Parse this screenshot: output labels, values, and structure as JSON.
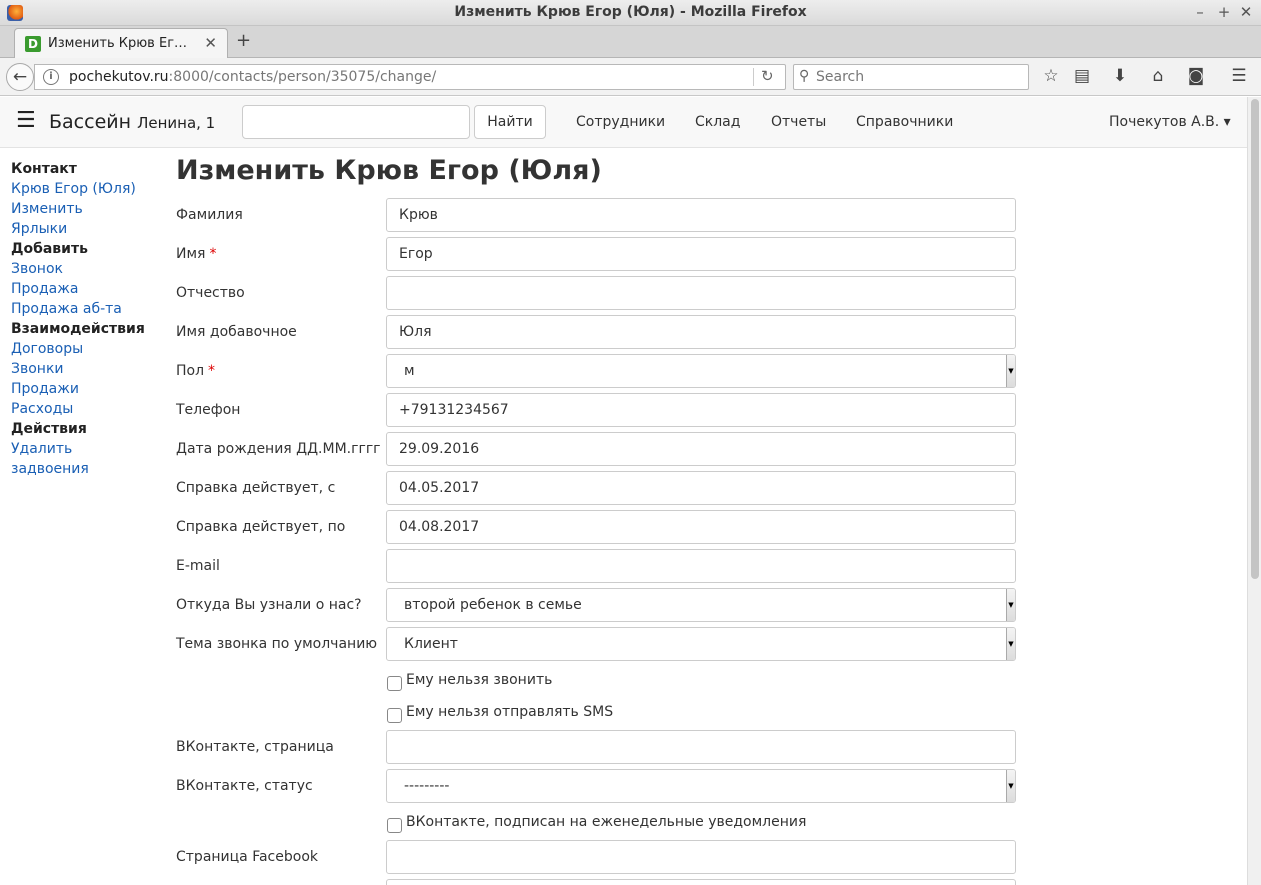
{
  "window": {
    "title": "Изменить Крюв Егор (Юля) - Mozilla Firefox"
  },
  "tab": {
    "label": "Изменить Крюв Ег…",
    "favicon": "D"
  },
  "urlbar": {
    "host": "pochekutov.ru",
    "path": ":8000/contacts/person/35075/change/"
  },
  "searchbar": {
    "placeholder": "Search"
  },
  "appnav": {
    "brand": "Бассейн",
    "brand_sub": "Ленина, 1",
    "search_value": "",
    "find_label": "Найти",
    "menu": [
      "Сотрудники",
      "Склад",
      "Отчеты",
      "Справочники"
    ],
    "user": "Почекутов А.В. ▾"
  },
  "sidebar": [
    {
      "text": "Контакт",
      "kind": "head"
    },
    {
      "text": "Крюв Егор (Юля)",
      "kind": "link"
    },
    {
      "text": "Изменить",
      "kind": "link"
    },
    {
      "text": "Ярлыки",
      "kind": "link"
    },
    {
      "text": "Добавить",
      "kind": "head"
    },
    {
      "text": "Звонок",
      "kind": "link"
    },
    {
      "text": "Продажа",
      "kind": "link"
    },
    {
      "text": "Продажа аб-та",
      "kind": "link"
    },
    {
      "text": "Взаимодействия",
      "kind": "head"
    },
    {
      "text": "Договоры",
      "kind": "link"
    },
    {
      "text": "Звонки",
      "kind": "link"
    },
    {
      "text": "Продажи",
      "kind": "link"
    },
    {
      "text": "Расходы",
      "kind": "link"
    },
    {
      "text": "Действия",
      "kind": "head"
    },
    {
      "text": "Удалить",
      "kind": "link"
    },
    {
      "text": "задвоения",
      "kind": "link"
    }
  ],
  "form": {
    "title": "Изменить Крюв Егор (Юля)",
    "fields": {
      "last_name": {
        "label": "Фамилия",
        "value": "Крюв"
      },
      "first_name": {
        "label": "Имя",
        "value": "Егор",
        "required": "*"
      },
      "patronymic": {
        "label": "Отчество",
        "value": ""
      },
      "extra_name": {
        "label": "Имя добавочное",
        "value": "Юля"
      },
      "gender": {
        "label": "Пол",
        "value": "м",
        "required": "*"
      },
      "phone": {
        "label": "Телефон",
        "value": "+79131234567"
      },
      "birth_date": {
        "label": "Дата рождения ДД.ММ.гггг",
        "value": "29.09.2016"
      },
      "cert_from": {
        "label": "Справка действует, с",
        "value": "04.05.2017"
      },
      "cert_to": {
        "label": "Справка действует, по",
        "value": "04.08.2017"
      },
      "email": {
        "label": "E-mail",
        "value": ""
      },
      "source": {
        "label": "Откуда Вы узнали о нас?",
        "value": "второй ребенок в семье"
      },
      "call_topic": {
        "label": "Тема звонка по умолчанию",
        "value": "Клиент"
      },
      "vk_page": {
        "label": "ВКонтакте, страница",
        "value": ""
      },
      "vk_status": {
        "label": "ВКонтакте, статус",
        "value": "---------"
      },
      "facebook": {
        "label": "Страница Facebook",
        "value": ""
      }
    },
    "checks": {
      "no_call": "Ему нельзя звонить",
      "no_sms": "Ему нельзя отправлять SMS",
      "vk_subscribed": "ВКонтакте, подписан на еженедельные уведомления"
    }
  }
}
